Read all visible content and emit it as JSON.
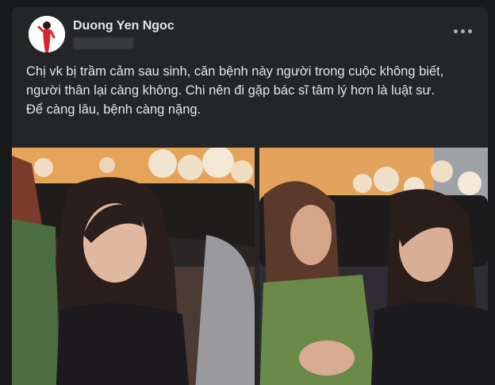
{
  "post": {
    "author": "Duong Yen Ngoc",
    "text_lines": [
      "Chị vk bị trầm cảm sau sinh, căn bệnh này người trong cuộc không biết, người thân lại càng không. Chi nên đi gặp bác sĩ tâm lý hơn là luật sư.",
      "Để càng lâu, bệnh càng nặng."
    ]
  },
  "icons": {
    "more": "more-horizontal-icon"
  },
  "colors": {
    "page_bg": "#18191a",
    "card_bg": "#242526",
    "text_primary": "#e4e6eb",
    "text_secondary": "#b0b3b8"
  }
}
